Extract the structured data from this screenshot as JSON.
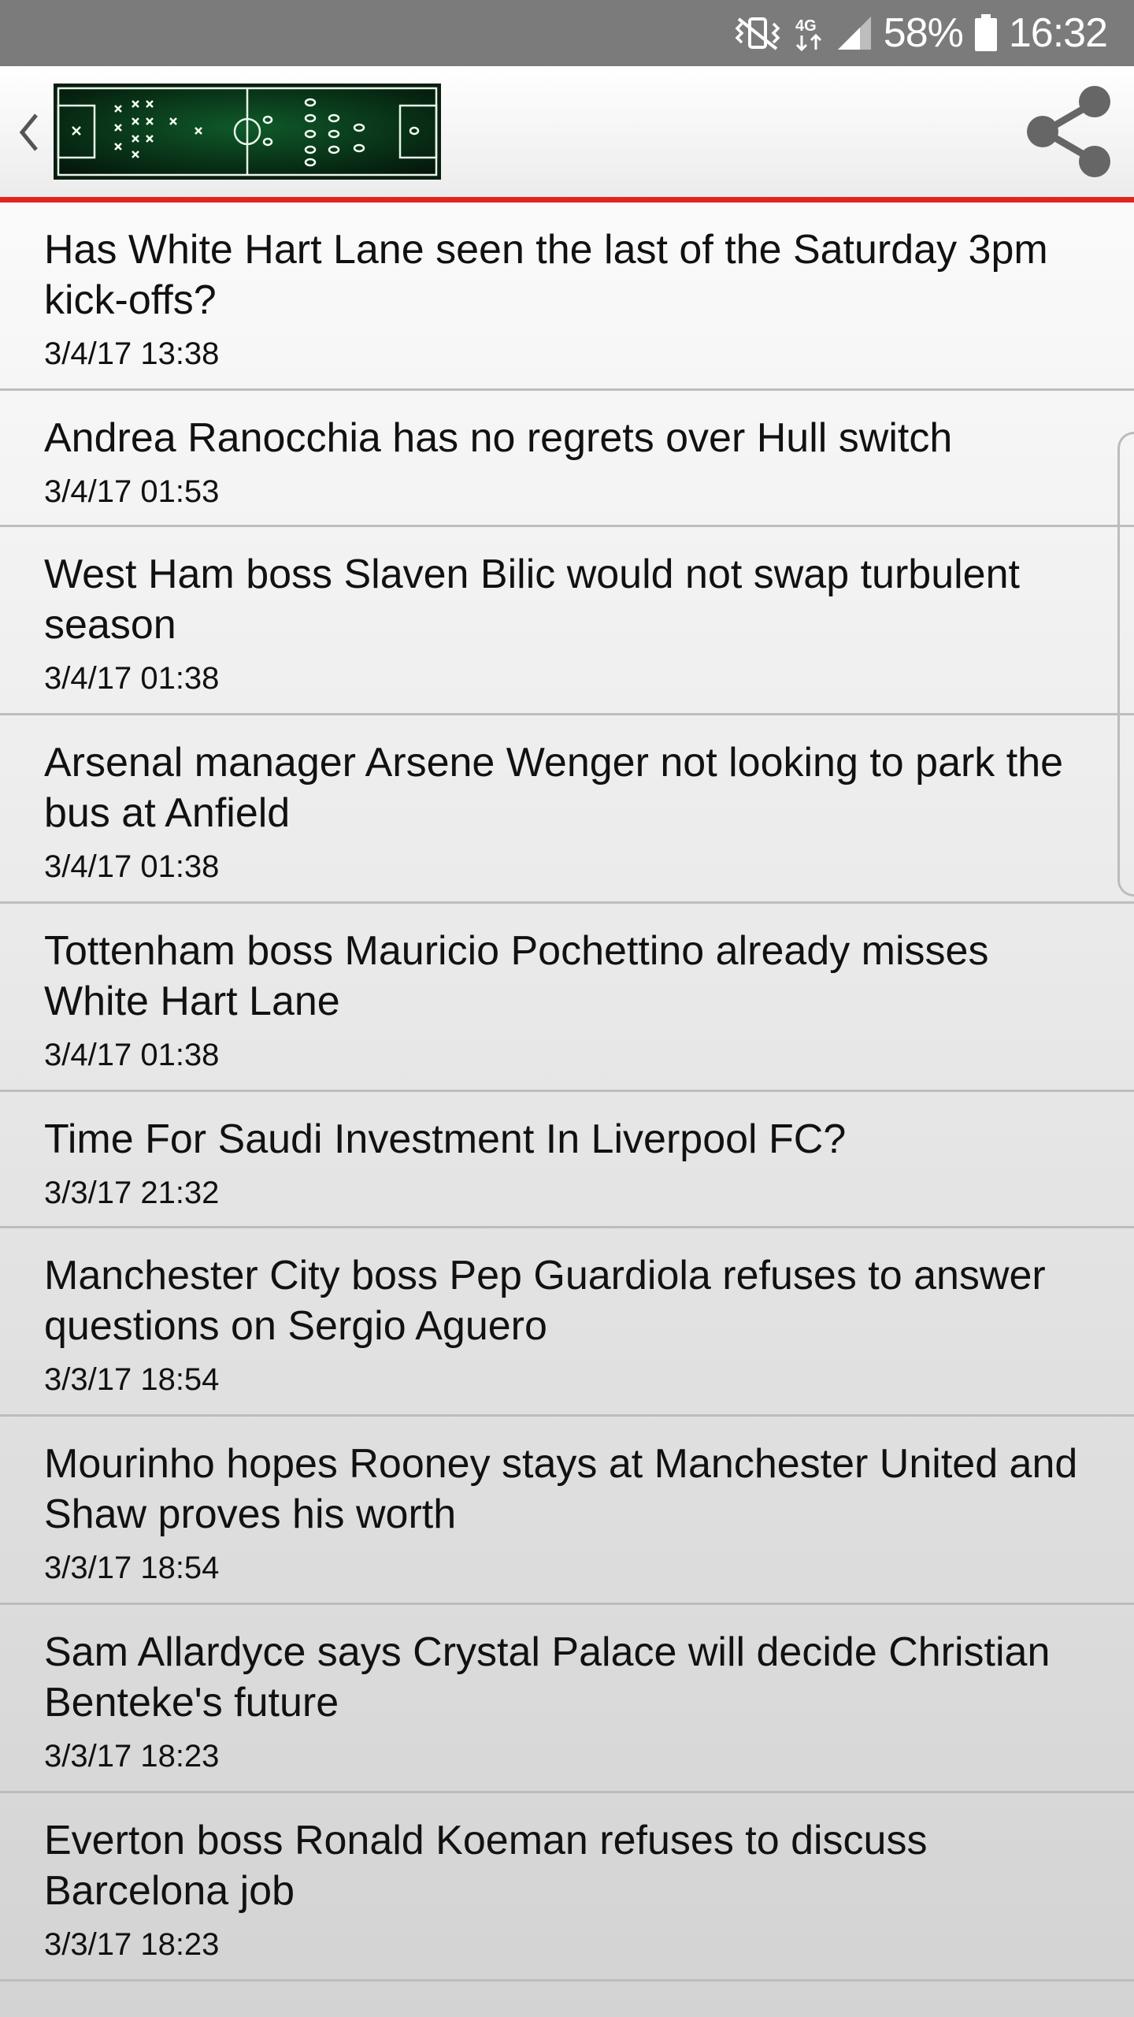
{
  "status_bar": {
    "battery": "58%",
    "time": "16:32",
    "network": "4G",
    "icons": [
      "mute-vibrate-icon",
      "4g-icon",
      "signal-icon",
      "battery-icon"
    ]
  },
  "app_bar": {
    "back_icon": "chevron-left-icon",
    "logo": "football-tactics-board-logo",
    "share_icon": "share-icon",
    "accent_color": "#e2241b"
  },
  "articles": [
    {
      "title": "Has White Hart Lane seen the last of the Saturday 3pm kick-offs?",
      "date": "3/4/17 13:38"
    },
    {
      "title": "Andrea Ranocchia has no regrets over Hull switch",
      "date": "3/4/17 01:53"
    },
    {
      "title": "West Ham boss Slaven Bilic would not swap turbulent season",
      "date": "3/4/17 01:38"
    },
    {
      "title": "Arsenal manager Arsene Wenger not looking to park the bus at Anfield",
      "date": "3/4/17 01:38"
    },
    {
      "title": "Tottenham boss Mauricio Pochettino already misses White Hart Lane",
      "date": "3/4/17 01:38"
    },
    {
      "title": "Time For Saudi Investment In Liverpool FC?",
      "date": "3/3/17 21:32"
    },
    {
      "title": "Manchester City boss Pep Guardiola refuses to answer questions on Sergio Aguero",
      "date": "3/3/17 18:54"
    },
    {
      "title": "Mourinho hopes Rooney stays at Manchester United and Shaw proves his worth",
      "date": "3/3/17 18:54"
    },
    {
      "title": "Sam Allardyce says Crystal Palace will decide Christian Benteke's future",
      "date": "3/3/17 18:23"
    },
    {
      "title": "Everton boss Ronald Koeman refuses to discuss Barcelona job",
      "date": "3/3/17 18:23"
    }
  ]
}
